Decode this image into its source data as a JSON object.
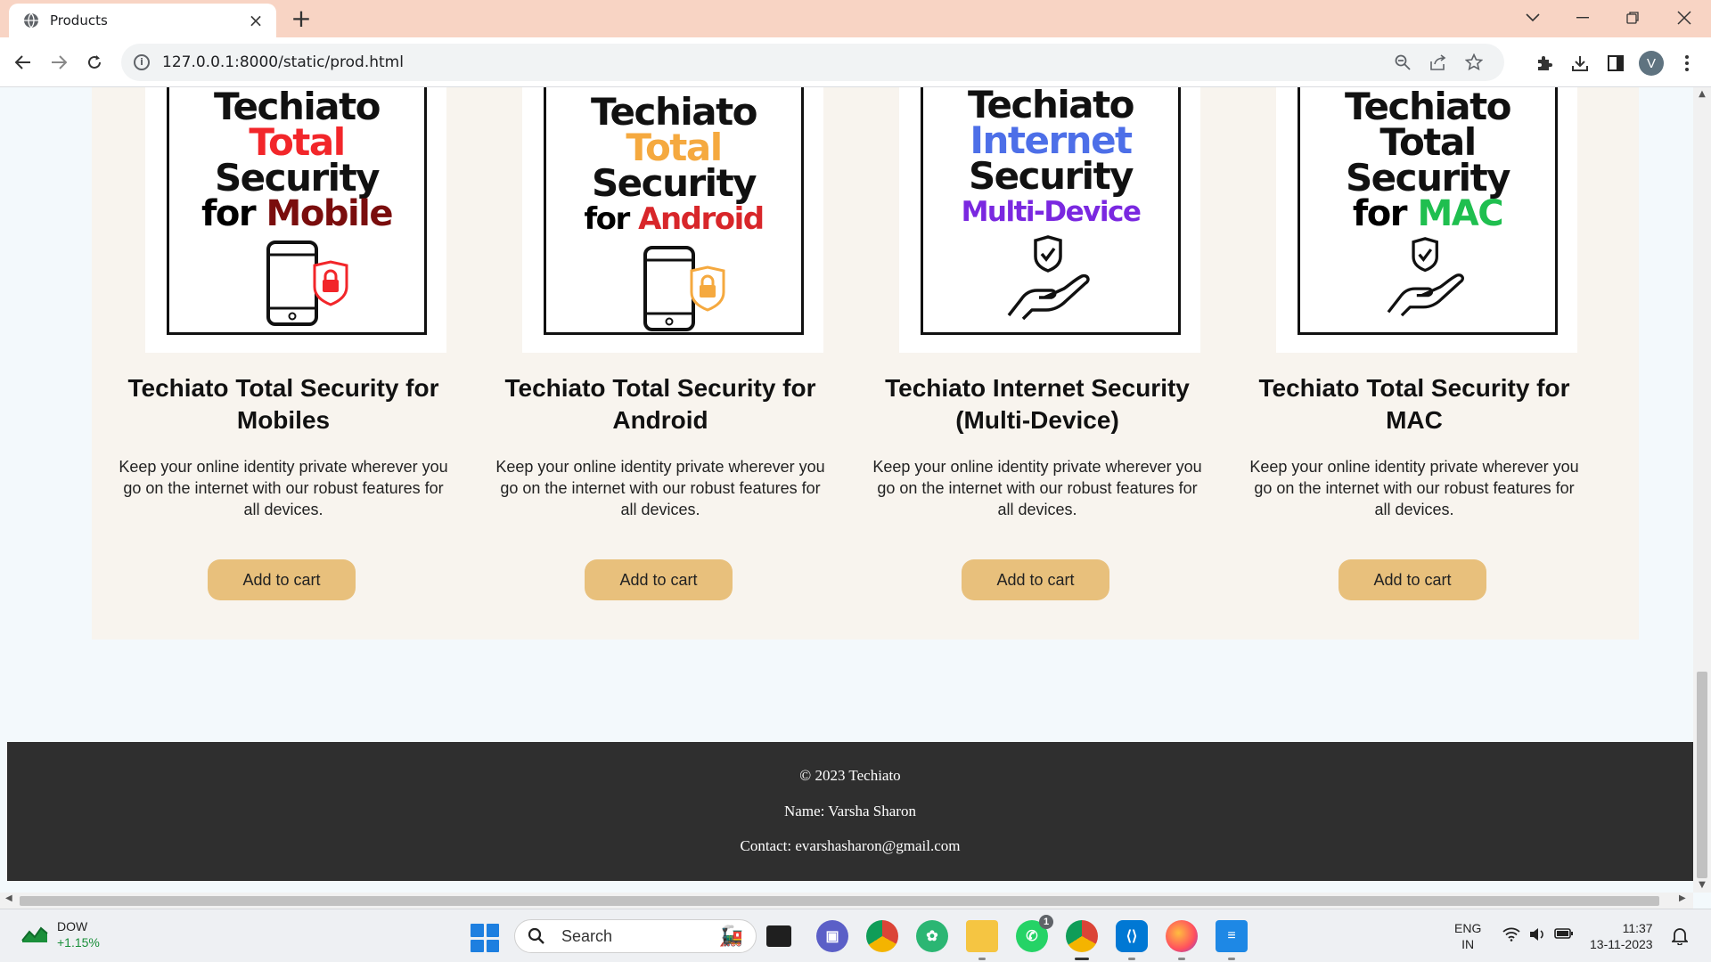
{
  "browser": {
    "tab_title": "Products",
    "tab_close": "×",
    "new_tab": "+",
    "url": "127.0.0.1:8000/static/prod.html",
    "profile_initial": "V"
  },
  "products": [
    {
      "poster": {
        "line1": "Techiato",
        "line2": "Total",
        "line3": "Security",
        "line4_prefix": "for ",
        "line4_accent": "Mobile",
        "accent2": "#f2262a",
        "accent4": "#7a0d0d"
      },
      "title": "Techiato Total Security for Mobiles",
      "description": "Keep your online identity private wherever you go on the internet with our robust features for all devices.",
      "button": "Add to cart"
    },
    {
      "poster": {
        "line1": "Techiato",
        "line2": "Total",
        "line3": "Security",
        "line4_prefix": "for ",
        "line4_accent": "Android",
        "accent2": "#f5a93f",
        "accent4": "#d8262a"
      },
      "title": "Techiato Total Security for Android",
      "description": "Keep your online identity private wherever you go on the internet with our robust features for all devices.",
      "button": "Add to cart"
    },
    {
      "poster": {
        "line1": "Techiato",
        "line2": "Internet",
        "line3": "Security",
        "line4_prefix": "",
        "line4_accent": "Multi-Device",
        "accent2": "#4d6fe8",
        "accent4": "#7a28e0"
      },
      "title": "Techiato Internet Security (Multi-Device)",
      "description": "Keep your online identity private wherever you go on the internet with our robust features for all devices.",
      "button": "Add to cart"
    },
    {
      "poster": {
        "line1": "Techiato",
        "line2": "Total",
        "line3": "Security",
        "line4_prefix": "for ",
        "line4_accent": "MAC",
        "accent2": "#111111",
        "accent4": "#1fbf4f"
      },
      "title": "Techiato Total Security for MAC",
      "description": "Keep your online identity private wherever you go on the internet with our robust features for all devices.",
      "button": "Add to cart"
    }
  ],
  "footer": {
    "copyright": "© 2023 Techiato",
    "name": "Name: Varsha Sharon",
    "contact": "Contact: evarshasharon@gmail.com"
  },
  "taskbar": {
    "widget_name": "DOW",
    "widget_change": "+1.15%",
    "search_placeholder": "Search",
    "lang_top": "ENG",
    "lang_bottom": "IN",
    "time": "11:37",
    "date": "13-11-2023",
    "whatsapp_badge": "1"
  },
  "colors": {
    "titlebar": "#f8d4c4",
    "button": "#e8c07c",
    "panel": "#f8f4ee",
    "footer": "#2f2f2f"
  }
}
